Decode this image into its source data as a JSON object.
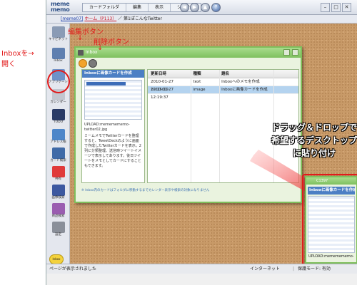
{
  "annotations": {
    "inbox_open_line1": "Inboxを→",
    "inbox_open_line2": "開く",
    "edit_button": "編集ボタン",
    "delete_button": "削除ボタン",
    "down_arrows": "↓",
    "drag_line1": "ドラッグ＆ドロップで",
    "drag_line2": "希望するデスクトップ",
    "drag_line3": "に貼り付け"
  },
  "app": {
    "logo_line1": "meme",
    "logo_line2": "memo",
    "menu": [
      "カードフォルダ",
      "編集",
      "表示",
      "システム"
    ],
    "crumb_user": "[meme07]",
    "crumb_home": "ホーム（P113）",
    "crumb_page": "／ 第1ぽこんなTwitter"
  },
  "sidebar": {
    "items": [
      {
        "label": "キャビネット",
        "color": "#8a9bb5"
      },
      {
        "label": "Inbox",
        "color": "#5f7fb0"
      },
      {
        "label": "アプリケーション",
        "color": "#6e92c9"
      },
      {
        "label": "カレンダー",
        "color": "#c2c6cf"
      },
      {
        "label": "TODO",
        "color": "#2a3b66"
      },
      {
        "label": "アドレス帳",
        "color": "#4d86c9"
      },
      {
        "label": "カード検索",
        "color": "#3f6aa7"
      },
      {
        "label": "共有",
        "color": "#e03a3a"
      },
      {
        "label": "画像検索",
        "color": "#3c58a0"
      },
      {
        "label": "商品検索",
        "color": "#9a5db0"
      },
      {
        "label": "設定",
        "color": "#8a8f99"
      }
    ]
  },
  "inbox": {
    "title": "Inbox",
    "preview_title": "Inboxに画像カードを作成",
    "preview_file": "UPLOAD:mememememo-twitter02.jpg",
    "preview_body": "ミームメモでTwitterカードを整理すると、TweetDeckのように画面で作成したTwitterカードを表示。2列に分類整理、送信時ツイートイメージで表示してあります。後日ツイートをメモとしてカードにすることもできます。",
    "columns": [
      "更新日時",
      "種類",
      "題名"
    ],
    "rows": [
      {
        "date": "2010-01-27 12:15:10",
        "type": "text",
        "title": "Inboxへのメモを作成",
        "selected": false
      },
      {
        "date": "2010-01-27 12:19:37",
        "type": "image",
        "title": "Inboxに画像カードを作成",
        "selected": true
      }
    ],
    "footer": "※ Inbox内のカードはフォルダに移動するまでカレンダー表示や検索の対象になりません"
  },
  "desktop_card": {
    "title": "C1397",
    "head": "Inboxに画像カードを作成",
    "file": "UPLOAD:mememememo-"
  },
  "status": {
    "left": "ページが表示されました",
    "internet": "インターネット",
    "separator": "|",
    "mode": "保護モード: 有効"
  },
  "badge": "Inbox"
}
